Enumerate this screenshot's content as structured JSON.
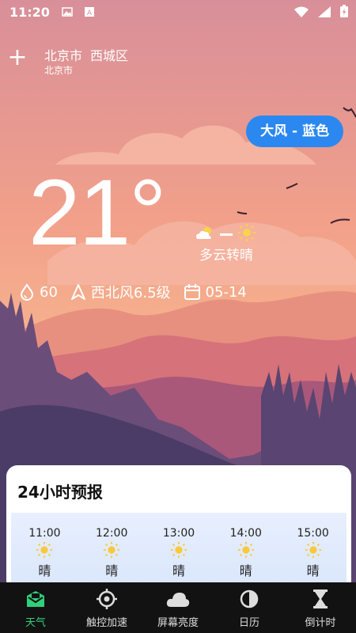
{
  "status_bar": {
    "time": "11:20",
    "icons_left": [
      "image-icon",
      "a-keyboard-icon"
    ],
    "icons_right": [
      "wifi-icon",
      "signal-icon",
      "battery-charging-icon"
    ]
  },
  "header": {
    "add_label": "+",
    "city": "北京市",
    "district": "西城区",
    "sub_city": "北京市"
  },
  "alert": {
    "label": "大风 - 蓝色",
    "color": "#2b88f0"
  },
  "current": {
    "temperature": "21°",
    "condition": "多云转晴",
    "humidity": "60",
    "wind": "西北风6.5级",
    "date": "05-14"
  },
  "forecast": {
    "title": "24小时预报",
    "hours": [
      {
        "time": "11:00",
        "desc": "晴"
      },
      {
        "time": "12:00",
        "desc": "晴"
      },
      {
        "time": "13:00",
        "desc": "晴"
      },
      {
        "time": "14:00",
        "desc": "晴"
      },
      {
        "time": "15:00",
        "desc": "晴"
      }
    ]
  },
  "nav": {
    "items": [
      {
        "label": "天气",
        "icon": "weather-mail-icon",
        "active": true
      },
      {
        "label": "触控加速",
        "icon": "target-icon",
        "active": false
      },
      {
        "label": "屏幕亮度",
        "icon": "cloud-icon",
        "active": false
      },
      {
        "label": "日历",
        "icon": "moon-phase-icon",
        "active": false
      },
      {
        "label": "倒计时",
        "icon": "hourglass-icon",
        "active": false
      }
    ],
    "active_color": "#2fd07a"
  }
}
